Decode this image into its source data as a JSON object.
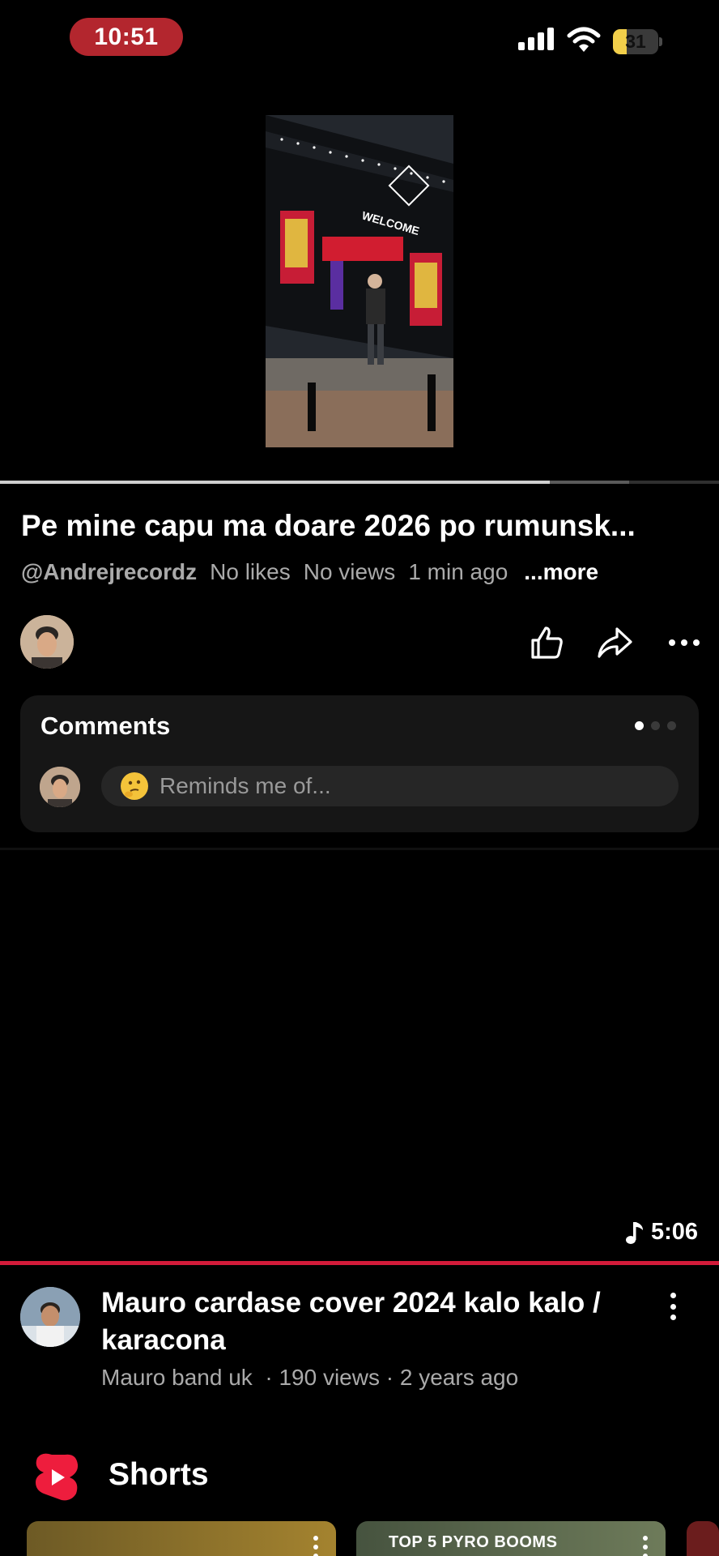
{
  "status_bar": {
    "time": "10:51",
    "battery_level": "31",
    "colors": {
      "time_pill": "#b3262e",
      "battery_fill": "#f2cf4a"
    }
  },
  "player": {
    "progress_played_fraction": 0.765,
    "progress_buffered_fraction": 0.875
  },
  "video": {
    "title": "Pe mine capu ma doare 2026 po rumunsk...",
    "channel": "@Andrejrecordz",
    "likes": "No likes",
    "views": "No views",
    "age": "1 min ago",
    "more_label": "...more"
  },
  "actions": {
    "like_icon": "thumbs-up-icon",
    "share_icon": "share-icon",
    "more_icon": "more-horizontal-icon"
  },
  "comments": {
    "title": "Comments",
    "placeholder": "Reminds me of...",
    "emoji_icon": "thinking-face-emoji"
  },
  "next_video": {
    "duration": "5:06",
    "title": "Mauro cardase cover 2024 kalo kalo / karacona",
    "channel": "Mauro band uk",
    "views": "190 views",
    "age": "2 years ago",
    "separator": "·"
  },
  "shorts": {
    "label": "Shorts",
    "items": [
      {
        "text": ""
      },
      {
        "text": "TOP 5 PYRO BOOMS"
      },
      {
        "text": ""
      }
    ]
  }
}
